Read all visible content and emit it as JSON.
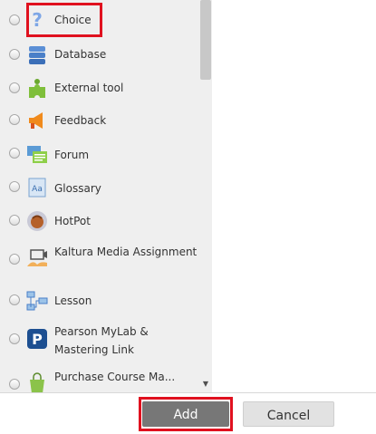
{
  "activities": [
    {
      "label": "Choice",
      "icon": "choice-icon"
    },
    {
      "label": "Database",
      "icon": "database-icon"
    },
    {
      "label": "External tool",
      "icon": "external-tool-icon"
    },
    {
      "label": "Feedback",
      "icon": "feedback-icon"
    },
    {
      "label": "Forum",
      "icon": "forum-icon"
    },
    {
      "label": "Glossary",
      "icon": "glossary-icon"
    },
    {
      "label": "HotPot",
      "icon": "hotpot-icon"
    },
    {
      "label": "Kaltura Media Assignment",
      "icon": "kaltura-media-icon"
    },
    {
      "label": "Lesson",
      "icon": "lesson-icon"
    },
    {
      "label": "Pearson MyLab & Mastering Link",
      "icon": "pearson-icon"
    },
    {
      "label": "Purchase Course Ma...",
      "icon": "purchase-course-icon"
    }
  ],
  "footer": {
    "add_label": "Add",
    "cancel_label": "Cancel"
  },
  "colors": {
    "highlight": "#e0111f",
    "add_button": "#777777",
    "cancel_button": "#e2e2e2",
    "panel": "#efefef"
  }
}
